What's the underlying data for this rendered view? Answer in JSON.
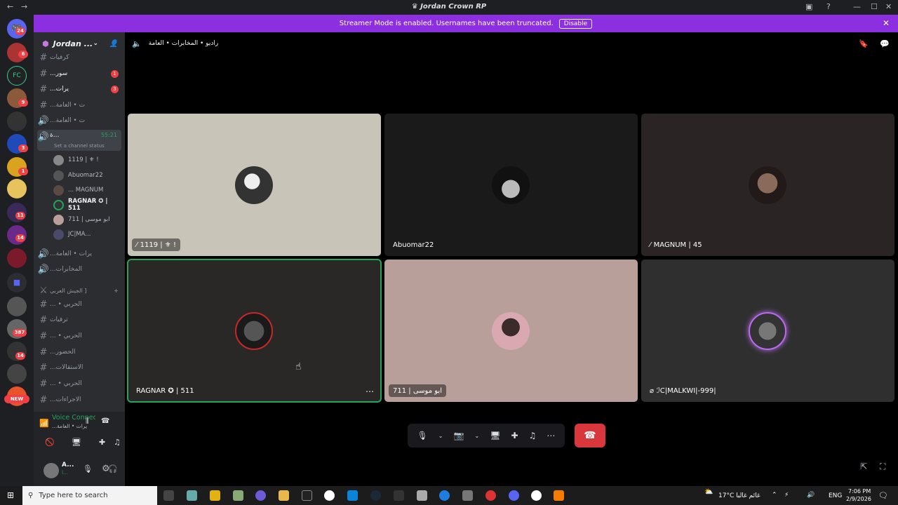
{
  "window": {
    "title": "Jordan Crown RP"
  },
  "banner": {
    "text": "Streamer Mode is enabled. Usernames have been truncated.",
    "button": "Disable"
  },
  "servers": {
    "badges": [
      "24",
      "6",
      "9",
      "3",
      "1",
      "11",
      "14",
      "387",
      "14"
    ],
    "new_label": "NEW"
  },
  "guild": {
    "name": "Jordan ..."
  },
  "channels": [
    {
      "type": "text",
      "name": "كرفيات",
      "badge": ""
    },
    {
      "type": "text",
      "name": "...سور",
      "badge": "1"
    },
    {
      "type": "text",
      "name": "...يرات",
      "badge": "3"
    },
    {
      "type": "voice",
      "name": "...ت • العامة",
      "badge": ""
    },
    {
      "type": "voice",
      "name": "...ت • العامة",
      "badge": ""
    },
    {
      "type": "voice",
      "name": "ة...",
      "badge": "",
      "active": true,
      "timer": "55:21",
      "status": "Set a channel status"
    }
  ],
  "voice_users": [
    "1119 | ⚜ !",
    "Abuomar22",
    "... MAGNUM",
    "RAGNAR ✪ | 511",
    "711 | ابو موسى",
    "JC|MA..."
  ],
  "channels2": [
    {
      "type": "voice",
      "name": "...يرات • العامة"
    },
    {
      "type": "voice",
      "name": "...المخابرات"
    },
    {
      "type": "category",
      "name": "الجيش العربي ]"
    },
    {
      "type": "text",
      "name": "... • الحربي"
    },
    {
      "type": "text",
      "name": "ترقيات"
    },
    {
      "type": "text",
      "name": "... • الحربي"
    },
    {
      "type": "text",
      "name": "...الحضور"
    },
    {
      "type": "text",
      "name": "...الاستقالات"
    },
    {
      "type": "text",
      "name": "... • الحربي"
    },
    {
      "type": "text",
      "name": "...الاجراءات"
    }
  ],
  "voice_panel": {
    "status": "Voice Connected",
    "channel": "...يرات • العامة",
    "user": "A...",
    "user_sub": "l..."
  },
  "channel_header": {
    "name": "راديو • المخابرات • العامة"
  },
  "tiles": [
    {
      "name": "1119 | ⚜ !",
      "bg": "#c8c5b8",
      "speaking": false,
      "muted": true
    },
    {
      "name": "Abuomar22",
      "bg": "#1a1a1a",
      "speaking": false,
      "muted": false
    },
    {
      "name": "MAGNUM | 45",
      "bg": "#2a2424",
      "speaking": false,
      "muted": true
    },
    {
      "name": "RAGNAR ✪ | 511",
      "bg": "#2a2826",
      "speaking": true,
      "muted": false
    },
    {
      "name": "711 | ابو موسى",
      "bg": "#b99f9a",
      "speaking": false,
      "muted": false
    },
    {
      "name": "ℐC|MALKWI|-999|",
      "bg": "#2f2f2f",
      "speaking": false,
      "muted": false
    }
  ],
  "taskbar": {
    "search_placeholder": "Type here to search",
    "weather": "17°C غائم غالبا",
    "lang": "ENG",
    "time": "7:06 PM",
    "date": "2/9/2026"
  },
  "colors": {
    "banner": "#8c2fe0",
    "speaking": "#23a55a",
    "hangup": "#da373c",
    "badge": "#f23f43"
  }
}
